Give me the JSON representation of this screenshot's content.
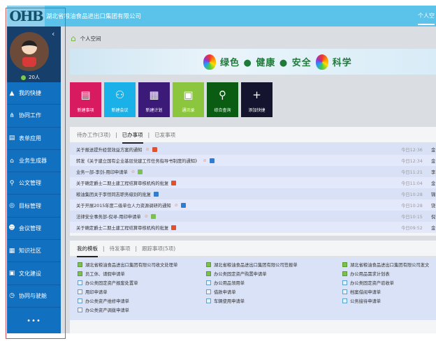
{
  "header": {
    "logo_text": "OHB",
    "title": "湖北省粮油食品进出口集团有限公司",
    "tab": "个人空"
  },
  "sidebar": {
    "online": "20人",
    "collapse": "‹",
    "more": "•••",
    "items": [
      {
        "label": "我的快捷",
        "icon": "▲"
      },
      {
        "label": "协同工作",
        "icon": "⋔"
      },
      {
        "label": "表单应用",
        "icon": "▤"
      },
      {
        "label": "业务生成器",
        "icon": "⌂"
      },
      {
        "label": "公文管理",
        "icon": "⚲"
      },
      {
        "label": "目标管理",
        "icon": "◎"
      },
      {
        "label": "会议管理",
        "icon": "☻"
      },
      {
        "label": "知识社区",
        "icon": "▦"
      },
      {
        "label": "文化建设",
        "icon": "▣"
      },
      {
        "label": "协同与驶舱",
        "icon": "◷"
      }
    ]
  },
  "breadcrumb": "个人空间",
  "banner": {
    "slogan_1": "绿色 ● 健康 ● 安全",
    "slogan_2": "科学"
  },
  "tiles": [
    {
      "label": "新建事项",
      "icon": "▤",
      "color": "#d81b60"
    },
    {
      "label": "新建会议",
      "icon": "⚇",
      "color": "#1ab0e8"
    },
    {
      "label": "新建计划",
      "icon": "▦",
      "color": "#3c1a78"
    },
    {
      "label": "通讯录",
      "icon": "▣",
      "color": "#8cc63f"
    },
    {
      "label": "综合查询",
      "icon": "⚲",
      "color": "#0a5c12"
    },
    {
      "label": "添加快捷",
      "icon": "+",
      "color": "#14142e"
    }
  ],
  "work": {
    "tabs": [
      "待办工作(3项)",
      "已办事项",
      "已发事项"
    ],
    "rows": [
      {
        "title": "关于报送提升经营效益方案的通知",
        "attach": true,
        "badge": "#e5502a",
        "time": "今日12:36",
        "who": "金"
      },
      {
        "title": "转发《关于建立国有企业基层党建工作任务指导书制度的通知》",
        "attach": true,
        "badge": "#2d7dd2",
        "time": "今日12:34",
        "who": "金"
      },
      {
        "title": "业务一部-李剑-用印申请单",
        "attach": true,
        "badge": "#7cc04f",
        "time": "今日11:21",
        "who": "李"
      },
      {
        "title": "关于确定爵士二期土建工程结算审核机构的批复",
        "attach": false,
        "badge": "#e5502a",
        "time": "今日11:04",
        "who": "金"
      },
      {
        "title": "粮油集团关于李恒同志职务级别的批复",
        "attach": false,
        "badge": "#2d7dd2",
        "time": "今日10:28",
        "who": "锦"
      },
      {
        "title": "关于开展2015年度二级单位人力资源调研的通知",
        "attach": true,
        "badge": "#2d7dd2",
        "time": "今日10:28",
        "who": "饶"
      },
      {
        "title": "法律安全事务部-倪寻-用印申请单",
        "attach": true,
        "badge": "#7cc04f",
        "time": "今日10:15",
        "who": "倪"
      },
      {
        "title": "关于确定爵士二期土建工程结算审核机构的批复",
        "attach": false,
        "badge": "#e5502a",
        "time": "今日09:52",
        "who": "金"
      }
    ]
  },
  "templates": {
    "tabs": [
      "我的模板",
      "待发事项",
      "跟踪事项(5项)"
    ],
    "items": [
      {
        "label": "湖北省粮油食品进出口集团有限公司收文处理单",
        "green": true
      },
      {
        "label": "湖北省粮油食品进出口集团有限公司签报单",
        "green": true
      },
      {
        "label": "湖北省粮油食品进出口集团有限公司发文",
        "green": true
      },
      {
        "label": "员工休、请假申请单",
        "green": true
      },
      {
        "label": "办公类固定资产购置申请单",
        "green": true
      },
      {
        "label": "办公用品需求计划表",
        "green": true
      },
      {
        "label": "办公类固定资产报废处置单",
        "green": false
      },
      {
        "label": "办公用品领用单",
        "green": false
      },
      {
        "label": "办公类固定资产验收单",
        "green": false
      },
      {
        "label": "用印申请单",
        "green": false
      },
      {
        "label": "借款申请单",
        "green": false
      },
      {
        "label": "档案借阅申请单",
        "green": false
      },
      {
        "label": "办公类资产维修申请单",
        "green": false
      },
      {
        "label": "车辆使用申请单",
        "green": false
      },
      {
        "label": "公务接待申请单",
        "green": false
      },
      {
        "label": "办公类资产调拨申请单",
        "green": false
      }
    ]
  }
}
